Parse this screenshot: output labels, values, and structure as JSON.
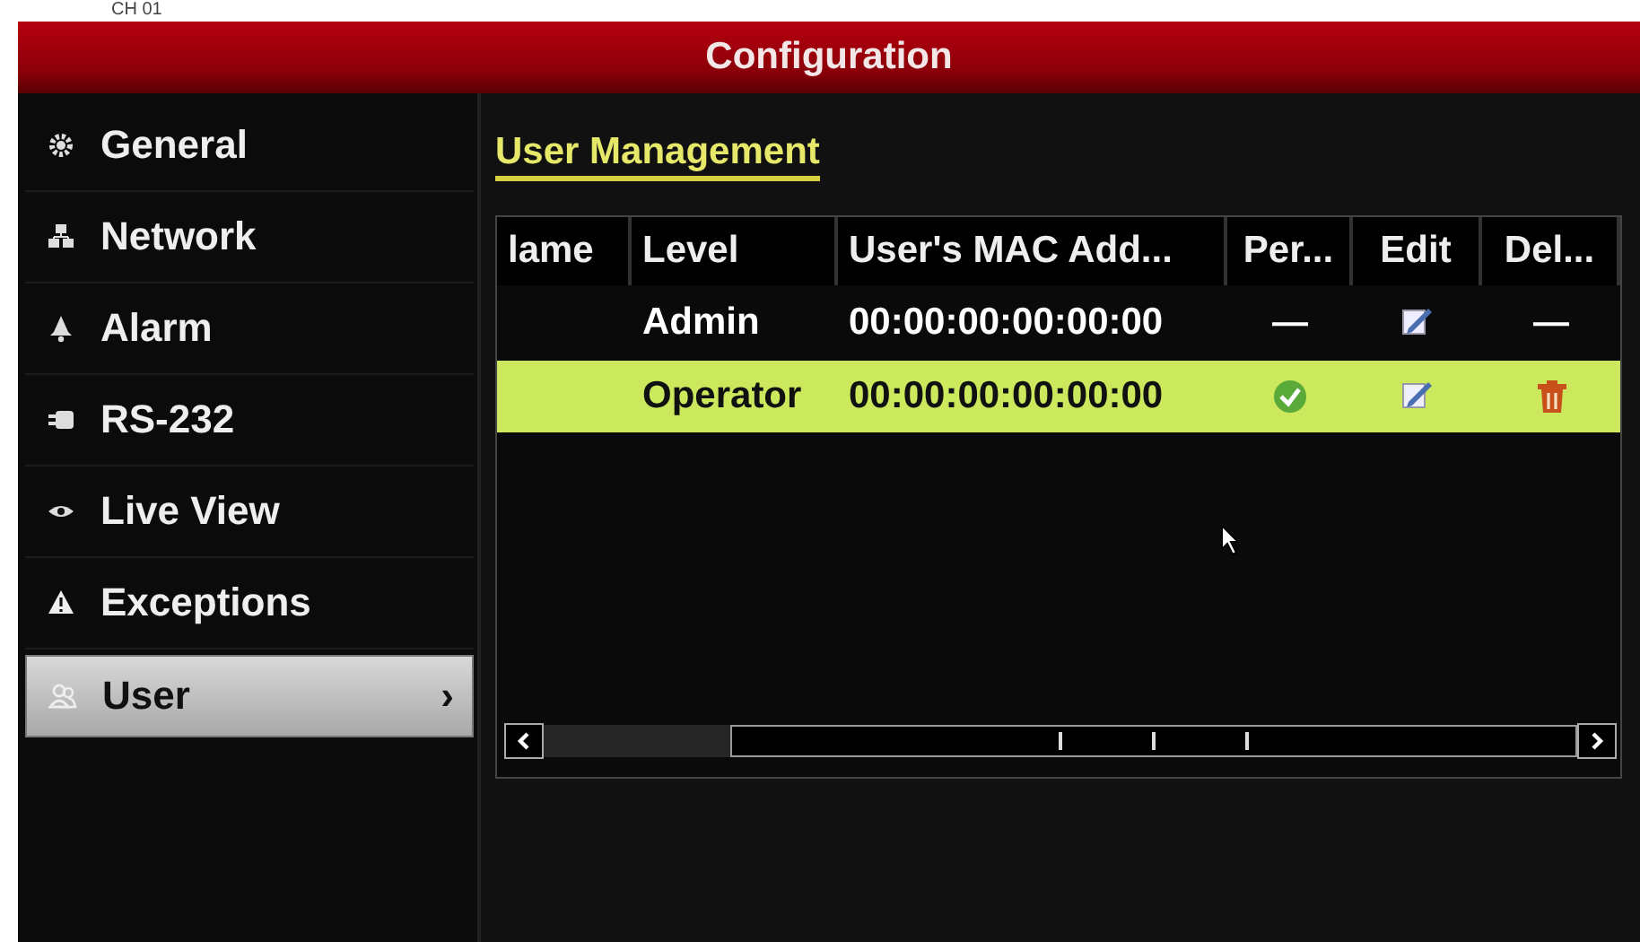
{
  "overlay_label": "CH 01",
  "window": {
    "title": "Configuration"
  },
  "sidebar": {
    "items": [
      {
        "label": "General",
        "selected": false
      },
      {
        "label": "Network",
        "selected": false
      },
      {
        "label": "Alarm",
        "selected": false
      },
      {
        "label": "RS-232",
        "selected": false
      },
      {
        "label": "Live View",
        "selected": false
      },
      {
        "label": "Exceptions",
        "selected": false
      },
      {
        "label": "User",
        "selected": true,
        "chevron": "›"
      }
    ]
  },
  "section_title": "User Management",
  "table": {
    "columns": [
      "lame",
      "Level",
      "User's MAC Add...",
      "Per...",
      "Edit",
      "Del..."
    ],
    "rows": [
      {
        "selected": false,
        "level": "Admin",
        "mac": "00:00:00:00:00:00",
        "permission": {
          "kind": "text",
          "text": "—"
        },
        "edit": {
          "kind": "edit"
        },
        "delete": {
          "kind": "text",
          "text": "—"
        }
      },
      {
        "selected": true,
        "level": "Operator",
        "mac": "00:00:00:00:00:00",
        "permission": {
          "kind": "check"
        },
        "edit": {
          "kind": "edit"
        },
        "delete": {
          "kind": "trash"
        }
      }
    ]
  }
}
